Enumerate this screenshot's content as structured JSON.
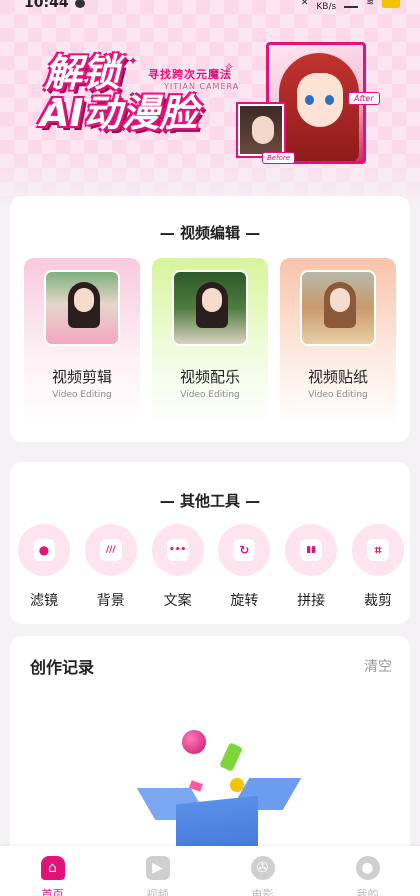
{
  "status_bar": {
    "time": "10:44",
    "speed": "72.4\nKB/s"
  },
  "banner": {
    "title_line1": "解锁",
    "title_line2": "AI动漫脸",
    "subtitle": "寻找跨次元魔法",
    "subtitle_en": "YITIAN CAMERA",
    "after_tag": "After",
    "before_tag": "Before"
  },
  "video_section": {
    "title": "— 视频编辑 —",
    "items": [
      {
        "label": "视频剪辑",
        "sub": "Video Editing"
      },
      {
        "label": "视频配乐",
        "sub": "Video Editing"
      },
      {
        "label": "视频贴纸",
        "sub": "Video Editing"
      }
    ]
  },
  "tools_section": {
    "title": "— 其他工具 —",
    "items": [
      {
        "label": "滤镜",
        "icon": "filter-icon",
        "glyph": "●"
      },
      {
        "label": "背景",
        "icon": "background-icon",
        "glyph": "///"
      },
      {
        "label": "文案",
        "icon": "text-icon",
        "glyph": "•••"
      },
      {
        "label": "旋转",
        "icon": "rotate-icon",
        "glyph": "↻"
      },
      {
        "label": "拼接",
        "icon": "splice-icon",
        "glyph": "▮▮"
      },
      {
        "label": "裁剪",
        "icon": "crop-icon",
        "glyph": "⌗"
      }
    ]
  },
  "records": {
    "title": "创作记录",
    "clear": "清空"
  },
  "bottom_nav": {
    "items": [
      {
        "label": "首页",
        "icon": "home-icon",
        "active": true
      },
      {
        "label": "视频",
        "icon": "video-icon",
        "active": false
      },
      {
        "label": "电影",
        "icon": "film-reel-icon",
        "active": false
      },
      {
        "label": "我的",
        "icon": "profile-icon",
        "active": false
      }
    ]
  },
  "colors": {
    "accent": "#e3127a",
    "background": "#f4f2f4",
    "banner_bg": "#fbd9ea"
  }
}
